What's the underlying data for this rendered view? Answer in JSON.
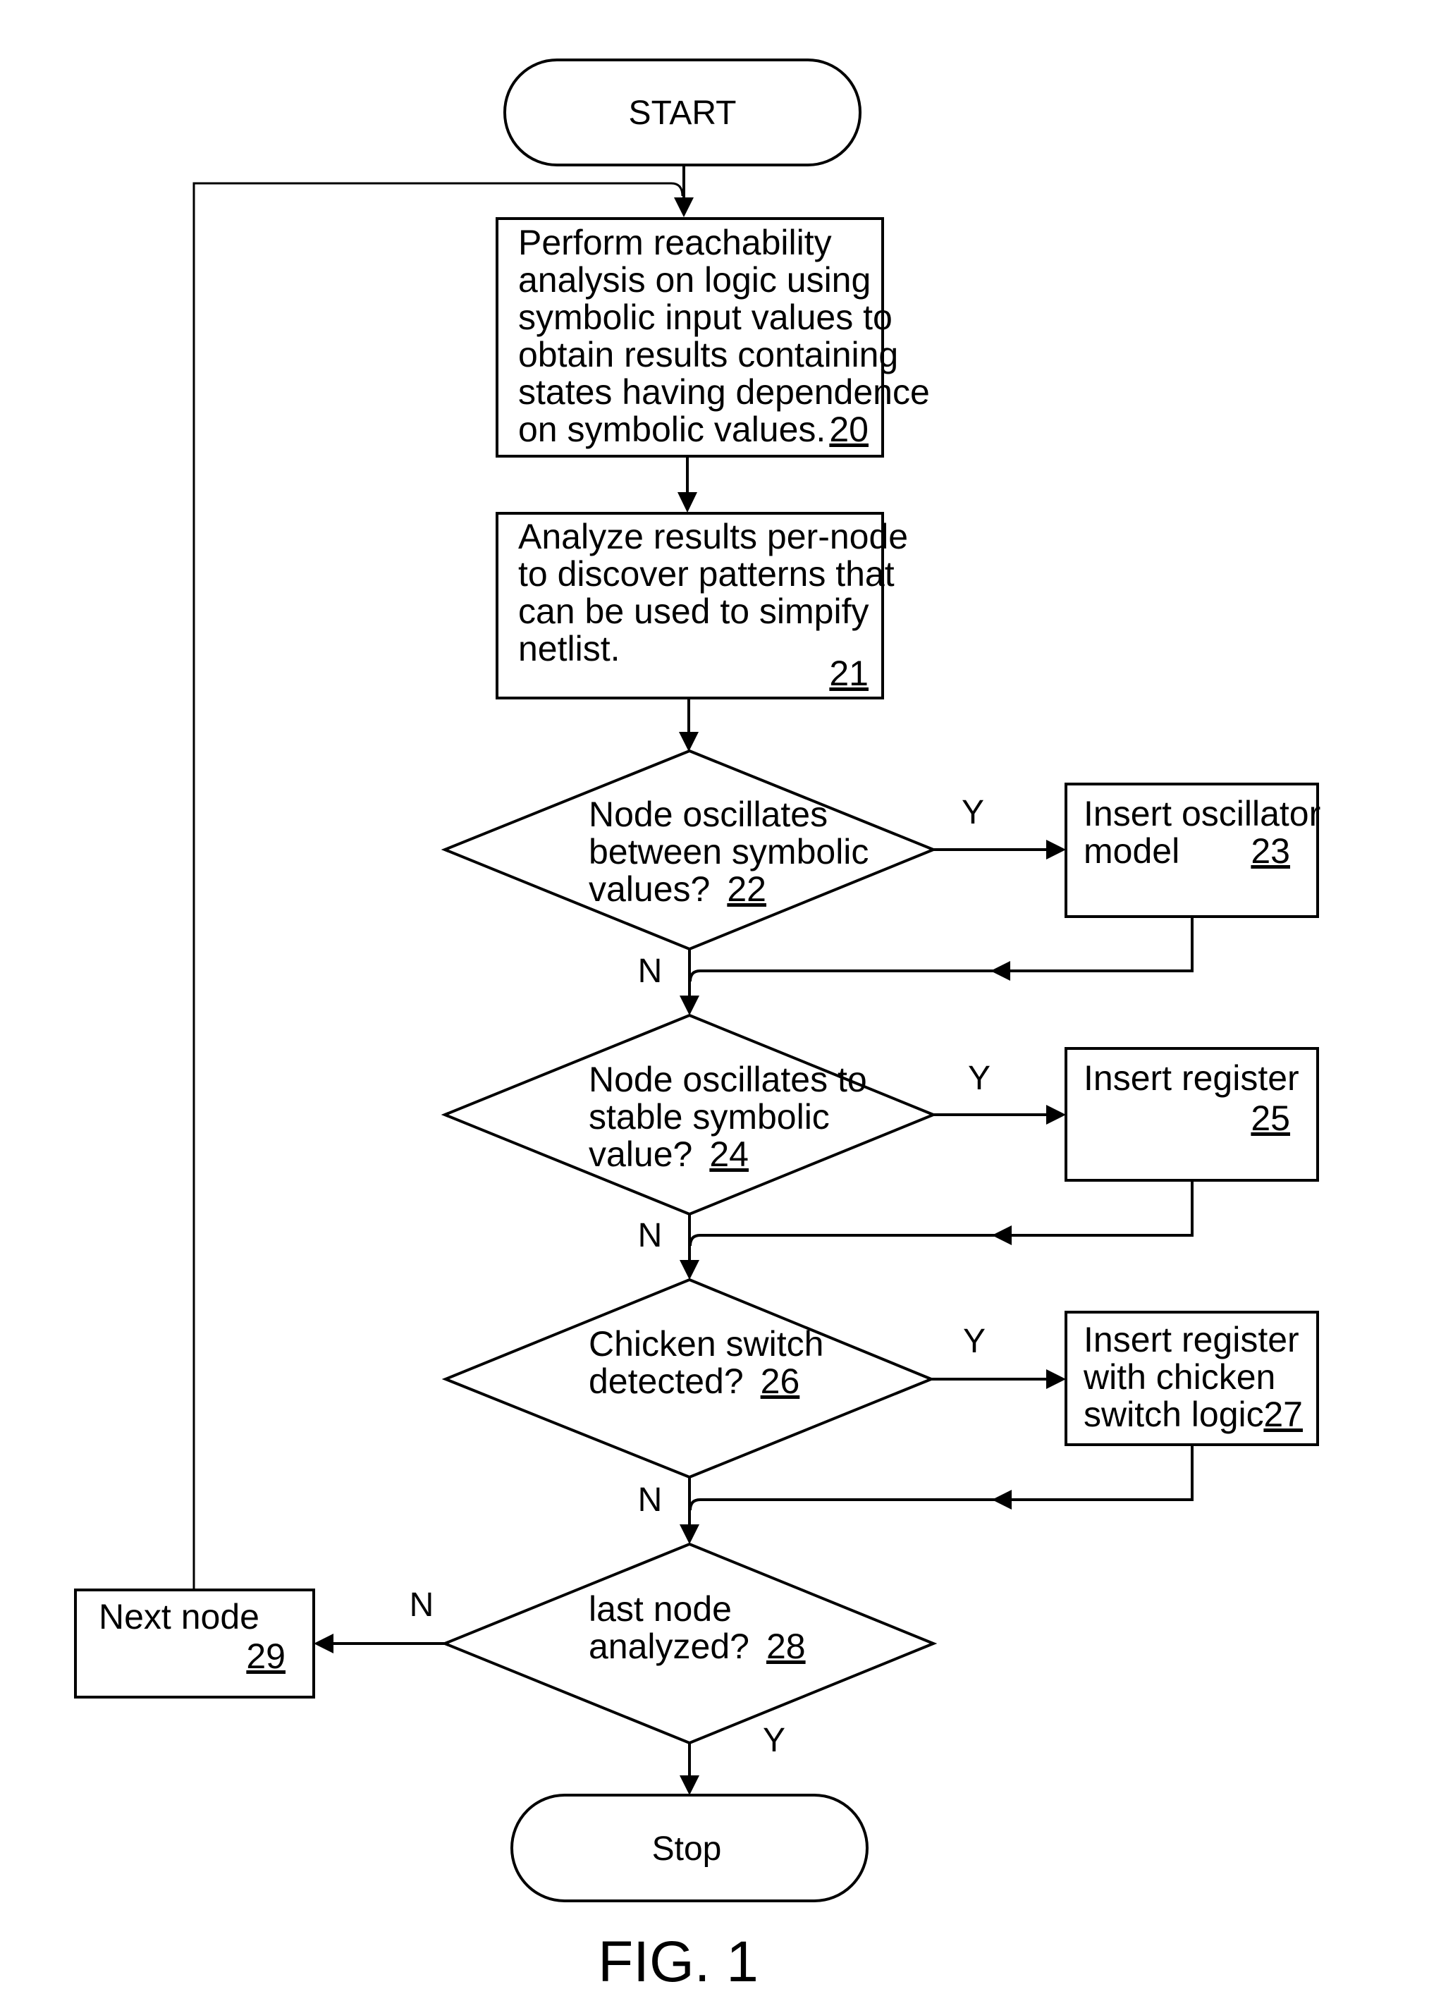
{
  "figure_label": "FIG. 1",
  "start": {
    "label": "START"
  },
  "stop": {
    "label": "Stop"
  },
  "steps": {
    "s20": {
      "lines": [
        "Perform reachability",
        "analysis on logic using",
        "symbolic input values to",
        "obtain results containing",
        "states having dependence",
        "on symbolic values."
      ],
      "ref": "20"
    },
    "s21": {
      "lines": [
        "Analyze results per-node",
        "to discover patterns that",
        "can be used to simpify",
        "netlist."
      ],
      "ref": "21"
    },
    "s23": {
      "lines": [
        "Insert oscillator",
        "model"
      ],
      "ref": "23"
    },
    "s25": {
      "lines": [
        "Insert register"
      ],
      "ref": "25"
    },
    "s27": {
      "lines": [
        "Insert register",
        "with chicken",
        "switch logic"
      ],
      "ref": "27"
    },
    "s29": {
      "lines": [
        "Next node"
      ],
      "ref": "29"
    }
  },
  "decisions": {
    "d22": {
      "lines": [
        "Node oscillates",
        "between symbolic",
        "values?"
      ],
      "ref": "22",
      "yes": "Y",
      "no": "N"
    },
    "d24": {
      "lines": [
        "Node oscillates to",
        "stable symbolic",
        "value?"
      ],
      "ref": "24",
      "yes": "Y",
      "no": "N"
    },
    "d26": {
      "lines": [
        "Chicken switch",
        "detected?"
      ],
      "ref": "26",
      "yes": "Y",
      "no": "N"
    },
    "d28": {
      "lines": [
        "last node",
        "analyzed?"
      ],
      "ref": "28",
      "yes": "Y",
      "no": "N"
    }
  }
}
